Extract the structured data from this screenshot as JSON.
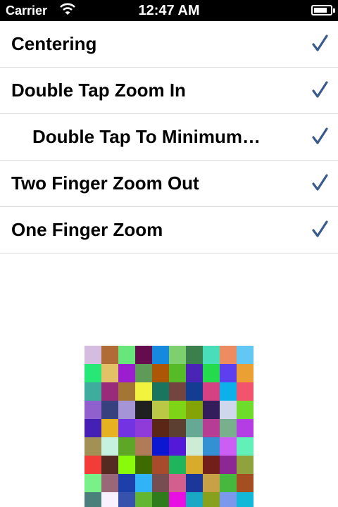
{
  "status_bar": {
    "carrier": "Carrier",
    "time": "12:47 AM",
    "wifi_icon": "wifi-icon",
    "battery_icon": "battery-icon",
    "battery_level": 0.8
  },
  "list": {
    "items": [
      {
        "label": "Centering",
        "checked": true,
        "indent": false
      },
      {
        "label": "Double Tap Zoom In",
        "checked": true,
        "indent": false
      },
      {
        "label": "Double Tap To Minimum…",
        "checked": true,
        "indent": true
      },
      {
        "label": "Two Finger Zoom Out",
        "checked": true,
        "indent": false
      },
      {
        "label": "One Finger Zoom",
        "checked": true,
        "indent": false
      }
    ],
    "check_color": "#3a5a8c",
    "check_icon": "checkmark-icon"
  },
  "image": {
    "name": "color-tile-grid",
    "colors": [
      [
        "#d4bde0",
        "#b06b36",
        "#66e67b",
        "#650c4f",
        "#1689de",
        "#7ed06e",
        "#3b7f4c",
        "#48deb9",
        "#ed8c60",
        "#62c7f5"
      ],
      [
        "#27e776",
        "#e2c167",
        "#9b1dd0",
        "#5e9a58",
        "#ad5606",
        "#55bc27",
        "#4924b5",
        "#23db4c",
        "#5e3fef",
        "#eaa033"
      ],
      [
        "#3fad9e",
        "#982b7a",
        "#a37636",
        "#f2f33e",
        "#1a7560",
        "#73453e",
        "#133c93",
        "#d64184",
        "#0cb1ea",
        "#f1546c"
      ],
      [
        "#9060ce",
        "#36417e",
        "#a695d6",
        "#202020",
        "#bbc846",
        "#7dd516",
        "#84a307",
        "#341d5b",
        "#ced7ec",
        "#6ddc2b"
      ],
      [
        "#4420b5",
        "#e7b222",
        "#7233e2",
        "#8f3bd9",
        "#5c2616",
        "#5d3f31",
        "#65a995",
        "#b73c93",
        "#78b08e",
        "#b43de4"
      ],
      [
        "#a29055",
        "#c5f1de",
        "#5ea625",
        "#b17b58",
        "#0c17d2",
        "#5419d8",
        "#ceebd6",
        "#3290d3",
        "#cd5ef5",
        "#63f0b8"
      ],
      [
        "#f23c37",
        "#552a21",
        "#89fa09",
        "#3d6a01",
        "#a84b2b",
        "#20b55d",
        "#d8ab2a",
        "#731f19",
        "#8c2793",
        "#8fa23c"
      ],
      [
        "#79f088",
        "#9a6779",
        "#1c3fa9",
        "#30b4f7",
        "#764e51",
        "#d25f8d",
        "#1b3898",
        "#c8a046",
        "#45b83d",
        "#a54e21"
      ],
      [
        "#4a8079",
        "#f7f2fe",
        "#3752ad",
        "#62b631",
        "#2f7c1c",
        "#e80fe2",
        "#1aa9c5",
        "#87a11c",
        "#7a98ec",
        "#11b8d8"
      ]
    ]
  }
}
